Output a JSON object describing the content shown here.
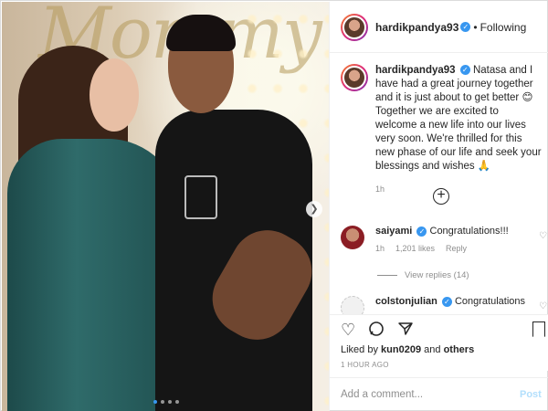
{
  "post": {
    "username": "hardikpandya93",
    "follow_status": "Following",
    "caption": "Natasa and I have had a great journey together and it is just about to get better 😊 Together we are excited to welcome a new life into our lives very soon. We're thrilled for this new phase of our life and seek your blessings and wishes 🙏",
    "caption_time": "1h",
    "photo_text": "Mommy",
    "carousel": {
      "count": 4,
      "active_index": 0
    }
  },
  "comments": [
    {
      "username": "saiyami",
      "text": "Congratulations!!!",
      "time": "1h",
      "likes": "1,201 likes",
      "reply_label": "Reply",
      "view_replies": "View replies (14)"
    },
    {
      "username": "colstonjulian",
      "text": "Congratulations"
    }
  ],
  "actions": {
    "liked_by_prefix": "Liked by",
    "liked_by_user": "kun0209",
    "liked_by_joiner": "and",
    "liked_by_others": "others",
    "posted_ago": "1 HOUR AGO"
  },
  "comment_box": {
    "placeholder": "Add a comment...",
    "post_label": "Post"
  },
  "icons": {
    "like": "heart-icon",
    "comment": "comment-icon",
    "share": "paper-plane-icon",
    "save": "bookmark-icon",
    "more_comments": "plus-circle-icon",
    "next_photo": "chevron-right-icon"
  },
  "colors": {
    "verified": "#3897f0",
    "secondary_text": "#8e8e8e",
    "post_button": "#b2dffc"
  }
}
